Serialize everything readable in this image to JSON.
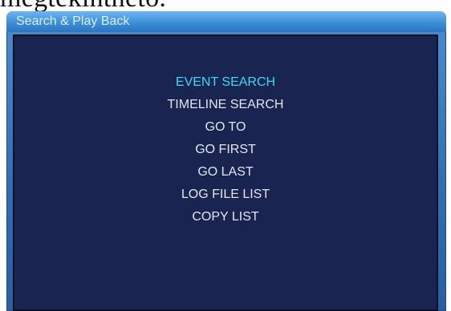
{
  "caption_fragment": "megtekinthető.",
  "window": {
    "title": "Search & Play Back"
  },
  "menu": {
    "items": [
      {
        "label": "EVENT SEARCH",
        "selected": true
      },
      {
        "label": "TIMELINE SEARCH",
        "selected": false
      },
      {
        "label": "GO TO",
        "selected": false
      },
      {
        "label": "GO FIRST",
        "selected": false
      },
      {
        "label": "GO LAST",
        "selected": false
      },
      {
        "label": "LOG FILE LIST",
        "selected": false
      },
      {
        "label": "COPY LIST",
        "selected": false
      }
    ]
  },
  "colors": {
    "panel_background": "#1a2450",
    "title_bar": "#3d8fd8",
    "selected_item": "#3fd8f2",
    "item_text": "#e2e6f0"
  }
}
